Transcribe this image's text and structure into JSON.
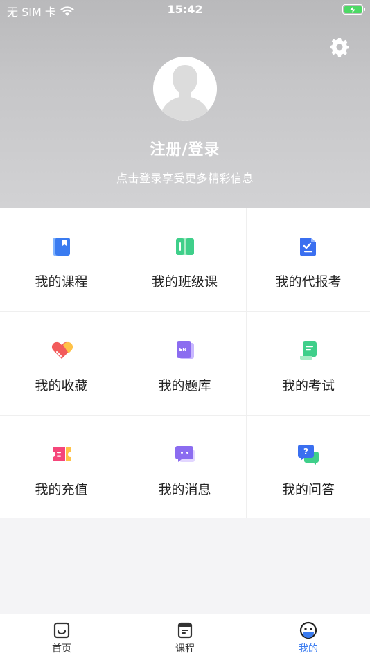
{
  "status_bar": {
    "carrier": "无 SIM 卡",
    "time": "15:42"
  },
  "profile": {
    "login_title": "注册/登录",
    "login_subtitle": "点击登录享受更多精彩信息"
  },
  "menu": [
    {
      "label": "我的课程",
      "icon": "course-book-icon"
    },
    {
      "label": "我的班级课",
      "icon": "class-book-icon"
    },
    {
      "label": "我的代报考",
      "icon": "exam-registration-icon"
    },
    {
      "label": "我的收藏",
      "icon": "favorite-heart-icon"
    },
    {
      "label": "我的题库",
      "icon": "question-bank-icon"
    },
    {
      "label": "我的考试",
      "icon": "exam-scroll-icon"
    },
    {
      "label": "我的充值",
      "icon": "recharge-ticket-icon"
    },
    {
      "label": "我的消息",
      "icon": "message-bubble-icon"
    },
    {
      "label": "我的问答",
      "icon": "qa-bubble-icon"
    }
  ],
  "tabbar": {
    "home": "首页",
    "courses": "课程",
    "mine": "我的"
  },
  "colors": {
    "accent": "#3a7bf0",
    "battery": "#4cd964"
  }
}
